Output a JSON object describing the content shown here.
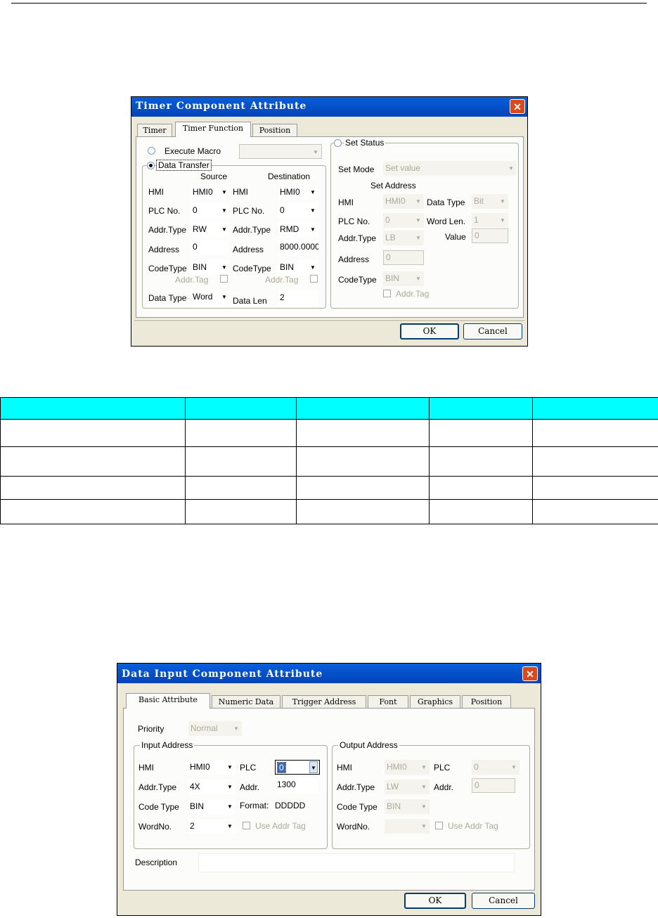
{
  "dialog1": {
    "title": "Timer Component Attribute",
    "close": "✕",
    "tabs": [
      "Timer",
      "Timer Function",
      "Position"
    ],
    "execute_macro": "Execute Macro",
    "data_transfer": "Data Transfer",
    "source": "Source",
    "destination": "Destination",
    "labels": {
      "hmi": "HMI",
      "plc_no": "PLC No.",
      "addr_type": "Addr.Type",
      "address": "Address",
      "code_type": "CodeType",
      "addr_tag": "Addr.Tag",
      "data_type": "Data Type",
      "data_len": "Data Len"
    },
    "src": {
      "hmi": "HMI0",
      "plc_no": "0",
      "addr_type": "RW",
      "address": "0",
      "code_type": "BIN",
      "data_type": "Word"
    },
    "dst": {
      "hmi": "HMI0",
      "plc_no": "0",
      "addr_type": "RMD",
      "address": "8000.0000",
      "code_type": "BIN",
      "data_len": "2"
    },
    "set_status": {
      "title": "Set Status",
      "set_mode_label": "Set Mode",
      "set_mode": "Set value",
      "set_address": "Set Address",
      "hmi_label": "HMI",
      "hmi": "HMI0",
      "plc_no_label": "PLC No.",
      "plc_no": "0",
      "addr_type_label": "Addr.Type",
      "addr_type": "LB",
      "address_label": "Address",
      "address": "0",
      "code_type_label": "CodeType",
      "code_type": "BIN",
      "data_type_label": "Data Type",
      "data_type": "Bit",
      "word_len_label": "Word Len.",
      "word_len": "1",
      "value_label": "Value",
      "value": "0",
      "addr_tag": "Addr.Tag"
    },
    "ok": "OK",
    "cancel": "Cancel"
  },
  "table": {
    "rows": 4
  },
  "dialog2": {
    "title": "Data Input Component Attribute",
    "close": "✕",
    "tabs": [
      "Basic Attribute",
      "Numeric Data",
      "Trigger Address",
      "Font",
      "Graphics",
      "Position"
    ],
    "priority_label": "Priority",
    "priority": "Normal",
    "input": {
      "title": "Input Address",
      "hmi_label": "HMI",
      "hmi": "HMI0",
      "plc_label": "PLC",
      "plc": "0",
      "addr_type_label": "Addr.Type",
      "addr_type": "4X",
      "addr_label": "Addr.",
      "addr": "1300",
      "code_type_label": "Code Type",
      "code_type": "BIN",
      "format_label": "Format:",
      "format": "DDDDD",
      "word_no_label": "WordNo.",
      "word_no": "2",
      "use_addr_tag": "Use Addr Tag"
    },
    "output": {
      "title": "Output Address",
      "hmi_label": "HMI",
      "hmi": "HMI0",
      "plc_label": "PLC",
      "plc": "0",
      "addr_type_label": "Addr.Type",
      "addr_type": "LW",
      "addr_label": "Addr.",
      "addr": "0",
      "code_type_label": "Code Type",
      "code_type": "BIN",
      "word_no_label": "WordNo.",
      "word_no": "",
      "use_addr_tag": "Use Addr Tag"
    },
    "description_label": "Description",
    "description": "",
    "ok": "OK",
    "cancel": "Cancel"
  }
}
